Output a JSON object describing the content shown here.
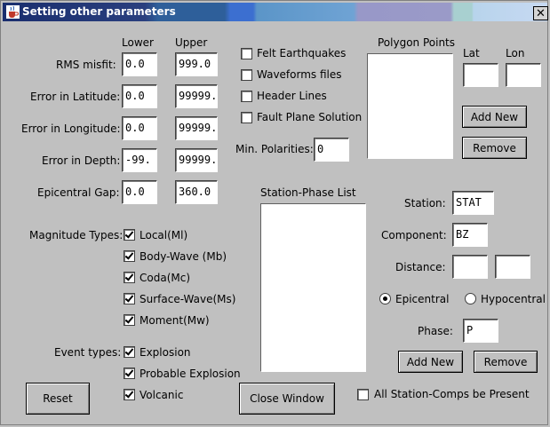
{
  "window": {
    "title": "Setting other parameters",
    "close_glyph": "✕"
  },
  "limits": {
    "lower_header": "Lower",
    "upper_header": "Upper",
    "rows": [
      {
        "label": "RMS misfit:",
        "lower": "0.0",
        "upper": "999.0"
      },
      {
        "label": "Error in Latitude:",
        "lower": "0.0",
        "upper": "99999."
      },
      {
        "label": "Error in Longitude:",
        "lower": "0.0",
        "upper": "99999."
      },
      {
        "label": "Error in Depth:",
        "lower": "-99.",
        "upper": "99999."
      },
      {
        "label": "Epicentral Gap:",
        "lower": "0.0",
        "upper": "360.0"
      }
    ]
  },
  "options": {
    "felt": {
      "label": "Felt Earthquakes",
      "checked": false
    },
    "waveforms": {
      "label": "Waveforms files",
      "checked": false
    },
    "header": {
      "label": "Header Lines",
      "checked": false
    },
    "fault": {
      "label": "Fault Plane Solution",
      "checked": false
    },
    "min_polarities_label": "Min. Polarities:",
    "min_polarities_value": "0"
  },
  "polygon": {
    "title": "Polygon Points",
    "lat_label": "Lat",
    "lon_label": "Lon",
    "lat_value": "",
    "lon_value": "",
    "add_label": "Add New",
    "remove_label": "Remove"
  },
  "magnitude": {
    "label": "Magnitude Types:",
    "items": [
      {
        "label": "Local(Ml)",
        "checked": true
      },
      {
        "label": "Body-Wave (Mb)",
        "checked": true
      },
      {
        "label": "Coda(Mc)",
        "checked": true
      },
      {
        "label": "Surface-Wave(Ms)",
        "checked": true
      },
      {
        "label": "Moment(Mw)",
        "checked": true
      }
    ]
  },
  "events": {
    "label": "Event types:",
    "items": [
      {
        "label": "Explosion",
        "checked": true
      },
      {
        "label": "Probable Explosion",
        "checked": true
      },
      {
        "label": "Volcanic",
        "checked": true
      }
    ]
  },
  "station_phase": {
    "title": "Station-Phase List",
    "station_label": "Station:",
    "station_value": "STAT",
    "component_label": "Component:",
    "component_value": "BZ",
    "distance_label": "Distance:",
    "distance_min": "",
    "distance_max": "",
    "epicentral_label": "Epicentral",
    "hypocentral_label": "Hypocentral",
    "phase_label": "Phase:",
    "phase_value": "P",
    "add_label": "Add New",
    "remove_label": "Remove",
    "all_present_label": "All Station-Comps be Present"
  },
  "buttons": {
    "reset": "Reset",
    "close": "Close Window"
  }
}
